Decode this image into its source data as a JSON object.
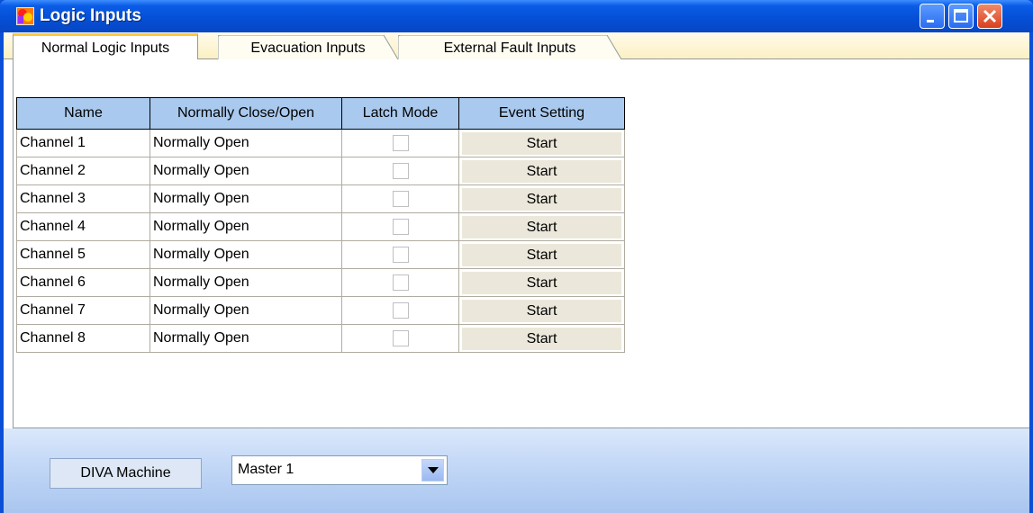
{
  "window": {
    "title": "Logic Inputs",
    "accent": "#0550d6"
  },
  "tabs": [
    {
      "label": "Normal Logic Inputs",
      "active": true
    },
    {
      "label": "Evacuation Inputs",
      "active": false
    },
    {
      "label": "External Fault Inputs",
      "active": false
    }
  ],
  "table": {
    "columns": [
      "Name",
      "Normally Close/Open",
      "Latch Mode",
      "Event Setting"
    ],
    "rows": [
      {
        "name": "Channel 1",
        "mode": "Normally Open",
        "latch": false,
        "event": "Start"
      },
      {
        "name": "Channel 2",
        "mode": "Normally Open",
        "latch": false,
        "event": "Start"
      },
      {
        "name": "Channel 3",
        "mode": "Normally Open",
        "latch": false,
        "event": "Start"
      },
      {
        "name": "Channel 4",
        "mode": "Normally Open",
        "latch": false,
        "event": "Start"
      },
      {
        "name": "Channel 5",
        "mode": "Normally Open",
        "latch": false,
        "event": "Start"
      },
      {
        "name": "Channel 6",
        "mode": "Normally Open",
        "latch": false,
        "event": "Start"
      },
      {
        "name": "Channel 7",
        "mode": "Normally Open",
        "latch": false,
        "event": "Start"
      },
      {
        "name": "Channel 8",
        "mode": "Normally Open",
        "latch": false,
        "event": "Start"
      }
    ]
  },
  "footer": {
    "machine_label": "DIVA Machine",
    "machine_select_value": "Master 1"
  }
}
